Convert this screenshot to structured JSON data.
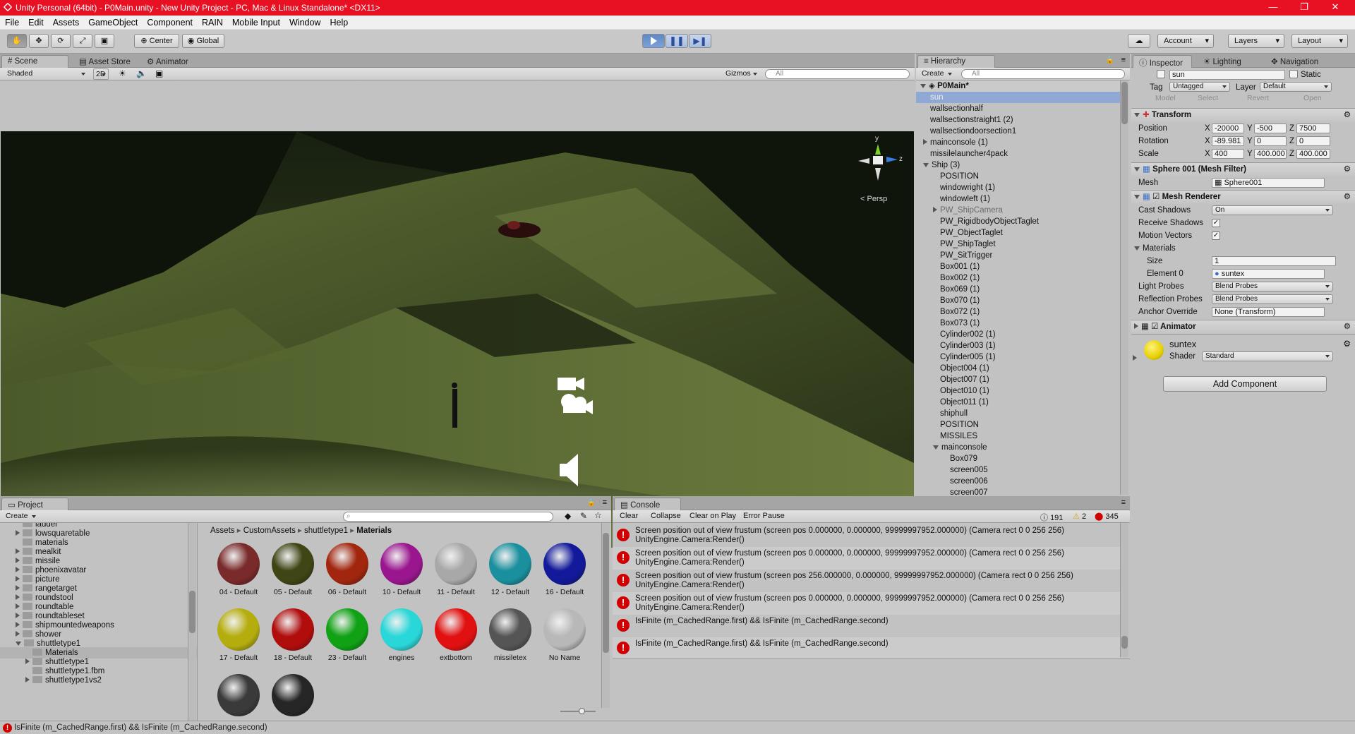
{
  "window": {
    "title": "Unity Personal (64bit) - P0Main.unity - New Unity Project - PC, Mac & Linux Standalone* <DX11>",
    "controls": [
      "—",
      "❐",
      "✕"
    ]
  },
  "menu": [
    "File",
    "Edit",
    "Assets",
    "GameObject",
    "Component",
    "RAIN",
    "Mobile Input",
    "Window",
    "Help"
  ],
  "toolbar": {
    "pivot_mode": "Center",
    "pivot_rotation": "Global",
    "account": "Account",
    "layers": "Layers",
    "layout": "Layout"
  },
  "scene": {
    "tabs": [
      "Scene",
      "Asset Store",
      "Animator"
    ],
    "shading": "Shaded",
    "mode_2d": "2D",
    "gizmos": "Gizmos",
    "search_placeholder": "All",
    "persp_label": "< Persp",
    "axis_y": "y",
    "axis_z": "z"
  },
  "hierarchy": {
    "tab": "Hierarchy",
    "create": "Create",
    "search_placeholder": "All",
    "scene_name": "P0Main*",
    "items": [
      {
        "label": "sun",
        "indent": 1,
        "selected": true,
        "arrow": ""
      },
      {
        "label": "wallsectionhalf",
        "indent": 1,
        "arrow": ""
      },
      {
        "label": "wallsectionstraight1 (2)",
        "indent": 1,
        "arrow": ""
      },
      {
        "label": "wallsectiondoorsection1",
        "indent": 1,
        "arrow": ""
      },
      {
        "label": "mainconsole (1)",
        "indent": 1,
        "arrow": "right"
      },
      {
        "label": "missilelauncher4pack",
        "indent": 1,
        "arrow": ""
      },
      {
        "label": "Ship (3)",
        "indent": 1,
        "arrow": "down"
      },
      {
        "label": "POSITION",
        "indent": 2,
        "arrow": ""
      },
      {
        "label": "windowright (1)",
        "indent": 2,
        "arrow": ""
      },
      {
        "label": "windowleft (1)",
        "indent": 2,
        "arrow": ""
      },
      {
        "label": "PW_ShipCamera",
        "indent": 2,
        "arrow": "right",
        "muted": true
      },
      {
        "label": "PW_RigidbodyObjectTaglet",
        "indent": 2,
        "arrow": ""
      },
      {
        "label": "PW_ObjectTaglet",
        "indent": 2,
        "arrow": ""
      },
      {
        "label": "PW_ShipTaglet",
        "indent": 2,
        "arrow": ""
      },
      {
        "label": "PW_SitTrigger",
        "indent": 2,
        "arrow": ""
      },
      {
        "label": "Box001 (1)",
        "indent": 2,
        "arrow": ""
      },
      {
        "label": "Box002 (1)",
        "indent": 2,
        "arrow": ""
      },
      {
        "label": "Box069 (1)",
        "indent": 2,
        "arrow": ""
      },
      {
        "label": "Box070 (1)",
        "indent": 2,
        "arrow": ""
      },
      {
        "label": "Box072 (1)",
        "indent": 2,
        "arrow": ""
      },
      {
        "label": "Box073 (1)",
        "indent": 2,
        "arrow": ""
      },
      {
        "label": "Cylinder002 (1)",
        "indent": 2,
        "arrow": ""
      },
      {
        "label": "Cylinder003 (1)",
        "indent": 2,
        "arrow": ""
      },
      {
        "label": "Cylinder005 (1)",
        "indent": 2,
        "arrow": ""
      },
      {
        "label": "Object004 (1)",
        "indent": 2,
        "arrow": ""
      },
      {
        "label": "Object007 (1)",
        "indent": 2,
        "arrow": ""
      },
      {
        "label": "Object010 (1)",
        "indent": 2,
        "arrow": ""
      },
      {
        "label": "Object011 (1)",
        "indent": 2,
        "arrow": ""
      },
      {
        "label": "shiphull",
        "indent": 2,
        "arrow": ""
      },
      {
        "label": "POSITION",
        "indent": 2,
        "arrow": ""
      },
      {
        "label": "MISSILES",
        "indent": 2,
        "arrow": ""
      },
      {
        "label": "mainconsole",
        "indent": 2,
        "arrow": "down"
      },
      {
        "label": "Box079",
        "indent": 3,
        "arrow": ""
      },
      {
        "label": "screen005",
        "indent": 3,
        "arrow": ""
      },
      {
        "label": "screen006",
        "indent": 3,
        "arrow": ""
      },
      {
        "label": "screen007",
        "indent": 3,
        "arrow": ""
      }
    ]
  },
  "inspector": {
    "tabs": [
      "Inspector",
      "Lighting",
      "Navigation"
    ],
    "object_name": "sun",
    "static_label": "Static",
    "tag_label": "Tag",
    "tag_value": "Untagged",
    "layer_label": "Layer",
    "layer_value": "Default",
    "prefab_buttons": [
      "Model",
      "Select",
      "Revert",
      "Open"
    ],
    "transform": {
      "header": "Transform",
      "position_label": "Position",
      "rotation_label": "Rotation",
      "scale_label": "Scale",
      "position": {
        "x": "-20000",
        "y": "-500",
        "z": "7500"
      },
      "rotation": {
        "x": "-89.981",
        "y": "0",
        "z": "0"
      },
      "scale": {
        "x": "400",
        "y": "400.000",
        "z": "400.000"
      },
      "axis_x": "X",
      "axis_y": "Y",
      "axis_z": "Z"
    },
    "mesh_filter": {
      "header": "Sphere 001 (Mesh Filter)",
      "mesh_label": "Mesh",
      "mesh_value": "Sphere001"
    },
    "mesh_renderer": {
      "header": "Mesh Renderer",
      "cast_shadows_label": "Cast Shadows",
      "cast_shadows": "On",
      "receive_shadows_label": "Receive Shadows",
      "motion_vectors_label": "Motion Vectors",
      "materials_label": "Materials",
      "size_label": "Size",
      "size_value": "1",
      "element0_label": "Element 0",
      "element0_value": "suntex",
      "light_probes_label": "Light Probes",
      "light_probes": "Blend Probes",
      "reflection_probes_label": "Reflection Probes",
      "reflection_probes": "Blend Probes",
      "anchor_override_label": "Anchor Override",
      "anchor_override": "None (Transform)"
    },
    "animator": {
      "header": "Animator"
    },
    "material": {
      "name": "suntex",
      "shader_label": "Shader",
      "shader_value": "Standard"
    },
    "add_component": "Add Component"
  },
  "project": {
    "tab": "Project",
    "create": "Create",
    "tree": [
      {
        "label": "ladder",
        "indent": 1,
        "arrow": ""
      },
      {
        "label": "lowsquaretable",
        "indent": 1,
        "arrow": "right"
      },
      {
        "label": "materials",
        "indent": 1,
        "arrow": ""
      },
      {
        "label": "mealkit",
        "indent": 1,
        "arrow": "right"
      },
      {
        "label": "missile",
        "indent": 1,
        "arrow": "right"
      },
      {
        "label": "phoenixavatar",
        "indent": 1,
        "arrow": "right"
      },
      {
        "label": "picture",
        "indent": 1,
        "arrow": "right"
      },
      {
        "label": "rangetarget",
        "indent": 1,
        "arrow": "right"
      },
      {
        "label": "roundstool",
        "indent": 1,
        "arrow": "right"
      },
      {
        "label": "roundtable",
        "indent": 1,
        "arrow": "right"
      },
      {
        "label": "roundtableset",
        "indent": 1,
        "arrow": "right"
      },
      {
        "label": "shipmountedweapons",
        "indent": 1,
        "arrow": "right"
      },
      {
        "label": "shower",
        "indent": 1,
        "arrow": "right"
      },
      {
        "label": "shuttletype1",
        "indent": 1,
        "arrow": "down"
      },
      {
        "label": "Materials",
        "indent": 2,
        "arrow": "",
        "selected": true
      },
      {
        "label": "shuttletype1",
        "indent": 2,
        "arrow": "right"
      },
      {
        "label": "shuttletype1.fbm",
        "indent": 2,
        "arrow": ""
      },
      {
        "label": "shuttletype1vs2",
        "indent": 2,
        "arrow": "right"
      }
    ],
    "breadcrumb": [
      "Assets",
      "CustomAssets",
      "shuttletype1",
      "Materials"
    ],
    "materials": [
      {
        "name": "04 - Default",
        "color": "#7a2a2a"
      },
      {
        "name": "05 - Default",
        "color": "#3f4514"
      },
      {
        "name": "06 - Default",
        "color": "#a2260e"
      },
      {
        "name": "10 - Default",
        "color": "#9a168f"
      },
      {
        "name": "11 - Default",
        "color": "#a8a8a8"
      },
      {
        "name": "12 - Default",
        "color": "#1a8f9e"
      },
      {
        "name": "16 - Default",
        "color": "#12199a"
      },
      {
        "name": "17 - Default",
        "color": "#b5ad0e"
      },
      {
        "name": "18 - Default",
        "color": "#b10d0d"
      },
      {
        "name": "23 - Default",
        "color": "#10a214"
      },
      {
        "name": "engines",
        "color": "#2ad7d8"
      },
      {
        "name": "extbottom",
        "color": "#e21111"
      },
      {
        "name": "missiletex",
        "color": "#555555"
      },
      {
        "name": "No Name",
        "color": "#b8b8b8"
      },
      {
        "name": "",
        "color": "#3a3a3a"
      },
      {
        "name": "",
        "color": "#262626"
      }
    ]
  },
  "console": {
    "tab": "Console",
    "buttons": [
      "Clear",
      "Collapse",
      "Clear on Play",
      "Error Pause"
    ],
    "counts": {
      "log": "191",
      "warn": "2",
      "error": "345"
    },
    "entries": [
      {
        "line1": "Screen position out of view frustum (screen pos 0.000000, 0.000000, 99999997952.000000) (Camera rect 0 0 256 256)",
        "line2": "UnityEngine.Camera:Render()"
      },
      {
        "line1": "Screen position out of view frustum (screen pos 0.000000, 0.000000, 99999997952.000000) (Camera rect 0 0 256 256)",
        "line2": "UnityEngine.Camera:Render()"
      },
      {
        "line1": "Screen position out of view frustum (screen pos 256.000000, 0.000000, 99999997952.000000) (Camera rect 0 0 256 256)",
        "line2": "UnityEngine.Camera:Render()"
      },
      {
        "line1": "Screen position out of view frustum (screen pos 0.000000, 0.000000, 99999997952.000000) (Camera rect 0 0 256 256)",
        "line2": "UnityEngine.Camera:Render()"
      },
      {
        "line1": "IsFinite (m_CachedRange.first) && IsFinite (m_CachedRange.second)",
        "line2": ""
      },
      {
        "line1": "IsFinite (m_CachedRange.first) && IsFinite (m_CachedRange.second)",
        "line2": ""
      }
    ]
  },
  "statusbar": {
    "message": "IsFinite (m_CachedRange.first) && IsFinite (m_CachedRange.second)"
  },
  "colors": {
    "titlebar": "#e81123",
    "error": "#d10000",
    "selection": "#8fa9d4"
  }
}
